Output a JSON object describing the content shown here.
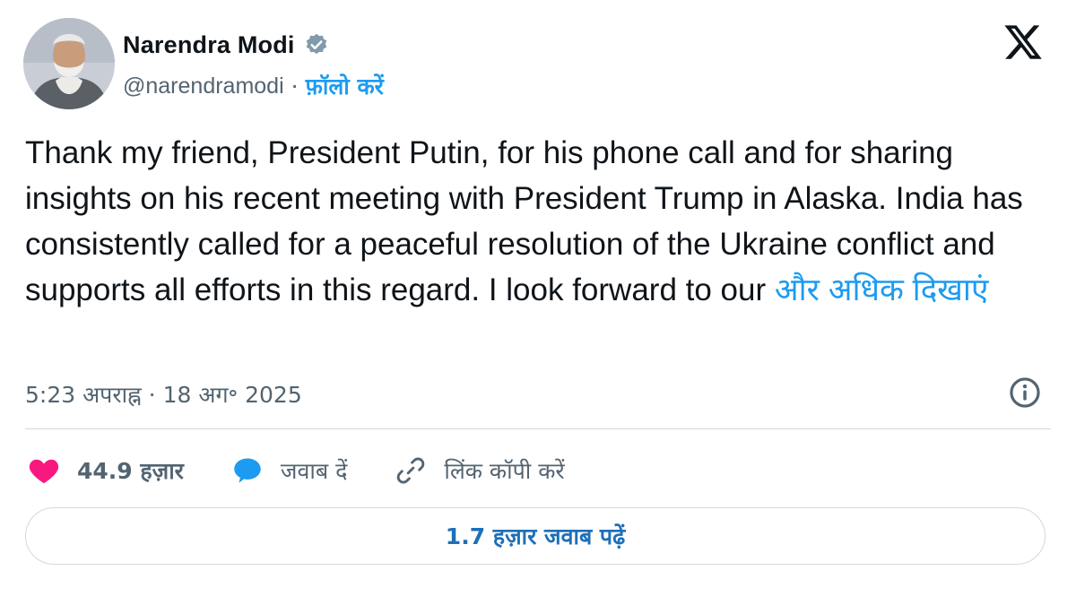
{
  "author": {
    "name": "Narendra Modi",
    "handle": "@narendramodi",
    "separator": "·",
    "follow_label": "फ़ॉलो करें"
  },
  "tweet": {
    "text": "Thank my friend, President Putin, for his phone call and for sharing insights on his recent meeting with President Trump in Alaska. India has consistently called for a peaceful resolution of the Ukraine conflict and supports all efforts in this regard. I look forward to our ",
    "show_more_label": "और अधिक दिखाएं"
  },
  "meta": {
    "time": "5:23 अपराह्न",
    "separator": "·",
    "date": "18 अग॰ 2025"
  },
  "actions": {
    "likes_count": "44.9 हज़ार",
    "reply_label": "जवाब दें",
    "copy_link_label": "लिंक कॉपी करें"
  },
  "replies_button_label": "1.7 हज़ार जवाब पढ़ें",
  "colors": {
    "accent": "#1d9bf0",
    "like": "#f91880",
    "secondary_text": "#536471",
    "verified": "#829aab"
  },
  "icons": {
    "verified": "verified-badge-icon",
    "logo": "x-logo-icon",
    "info": "info-icon",
    "like": "heart-icon",
    "reply": "speech-bubble-icon",
    "copy_link": "link-icon"
  }
}
